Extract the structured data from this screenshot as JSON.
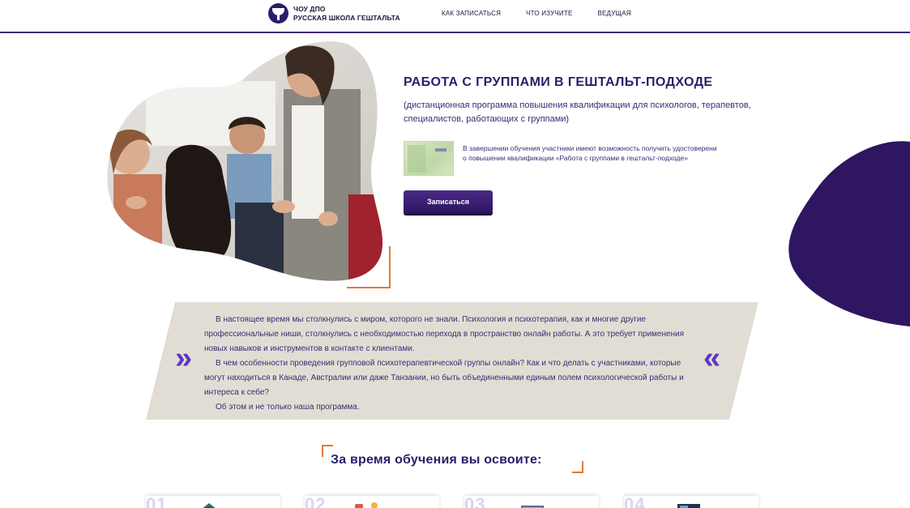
{
  "header": {
    "logo_line1": "ЧОУ ДПО",
    "logo_line2": "РУССКАЯ ШКОЛА ГЕШТАЛЬТА",
    "nav": [
      "КАК ЗАПИСАТЬСЯ",
      "ЧТО ИЗУЧИТЕ",
      "ВЕДУЩАЯ"
    ]
  },
  "hero": {
    "title": "РАБОТА С ГРУППАМИ В ГЕШТАЛЬТ-ПОДХОДЕ",
    "subtitle": "(дистанционная программа повышения квалификации для психологов, терапевтов, специалистов, работающих с группами)",
    "certificate_text": "В завершении обучения участники имеют возможность получить удостоверени о повышении квалификации «Работа с группами в гештальт-подходе»",
    "cta_label": "Записаться"
  },
  "intro": {
    "paragraphs": [
      "В настоящее время мы столкнулись с миром, которого не знали. Психология и психотерапия, как и многие другие профессиональные ниши, столкнулись с необходимостью перехода в пространство онлайн работы. А это требует применения новых навыков и инструментов в контакте с клиентами.",
      "В чем особенности проведения групповой психотерапевтической группы онлайн? Как и что делать с участниками, которые могут находиться в Канаде, Австралии или даже Танзании, но быть объединенными единым полем психологической работы и интереса к себе?",
      "Об этом и не только наша программа."
    ],
    "arrow_left": "»",
    "arrow_right": "«"
  },
  "section": {
    "title": "За время обучения вы освоите:"
  },
  "cards": [
    {
      "num": "01",
      "icon": "building-icon"
    },
    {
      "num": "02",
      "icon": "people-icon"
    },
    {
      "num": "03",
      "icon": "laptop-icon"
    },
    {
      "num": "04",
      "icon": "video-icon"
    }
  ],
  "colors": {
    "brand": "#2a1d6b",
    "accent": "#e07a36",
    "panel": "#e2ddd4",
    "arrow": "#5a35c4"
  }
}
